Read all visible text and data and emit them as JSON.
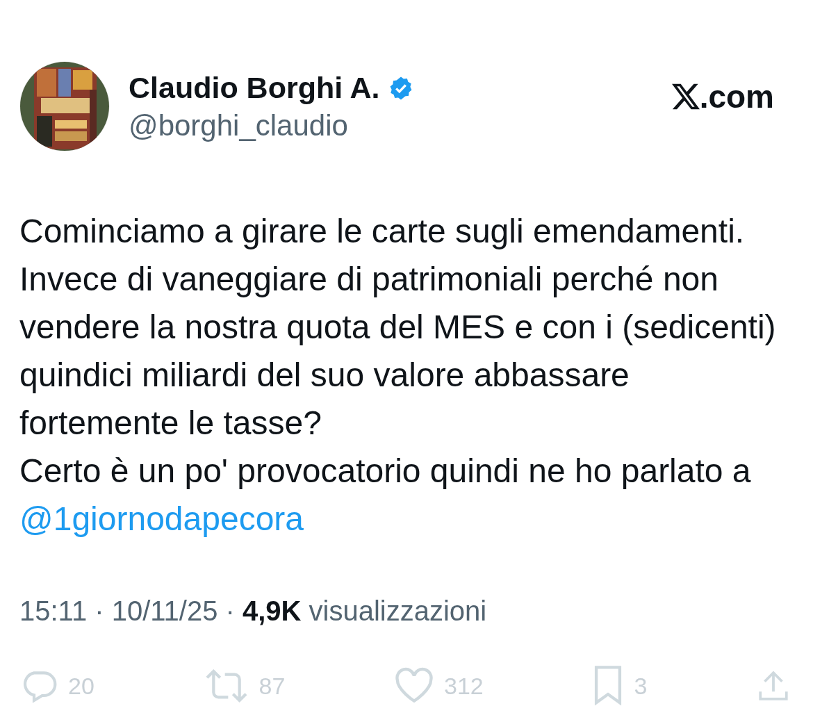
{
  "author": {
    "name": "Claudio Borghi A.",
    "verified": true,
    "handle": "@borghi_claudio"
  },
  "source": {
    "suffix": ".com"
  },
  "paragraphs": [
    {
      "text": "Cominciamo a girare le carte sugli emendamenti."
    },
    {
      "text": "Invece di vaneggiare di patrimoniali perché non vendere la nostra quota del MES e con i (sedicenti) quindici miliardi del suo valore abbassare fortemente le tasse?"
    },
    {
      "text": "Certo è un po' provocatorio quindi ne ho parlato a",
      "mention": "@1giornodapecora"
    }
  ],
  "meta": "15:11 · 10/11/25 · **4,9K** visualizzazioni",
  "actions": [
    {
      "kind": "reply",
      "count": "20"
    },
    {
      "kind": "repost",
      "count": "87"
    },
    {
      "kind": "like",
      "count": "312"
    },
    {
      "kind": "bookmark",
      "count": "3"
    },
    {
      "kind": "share"
    }
  ]
}
